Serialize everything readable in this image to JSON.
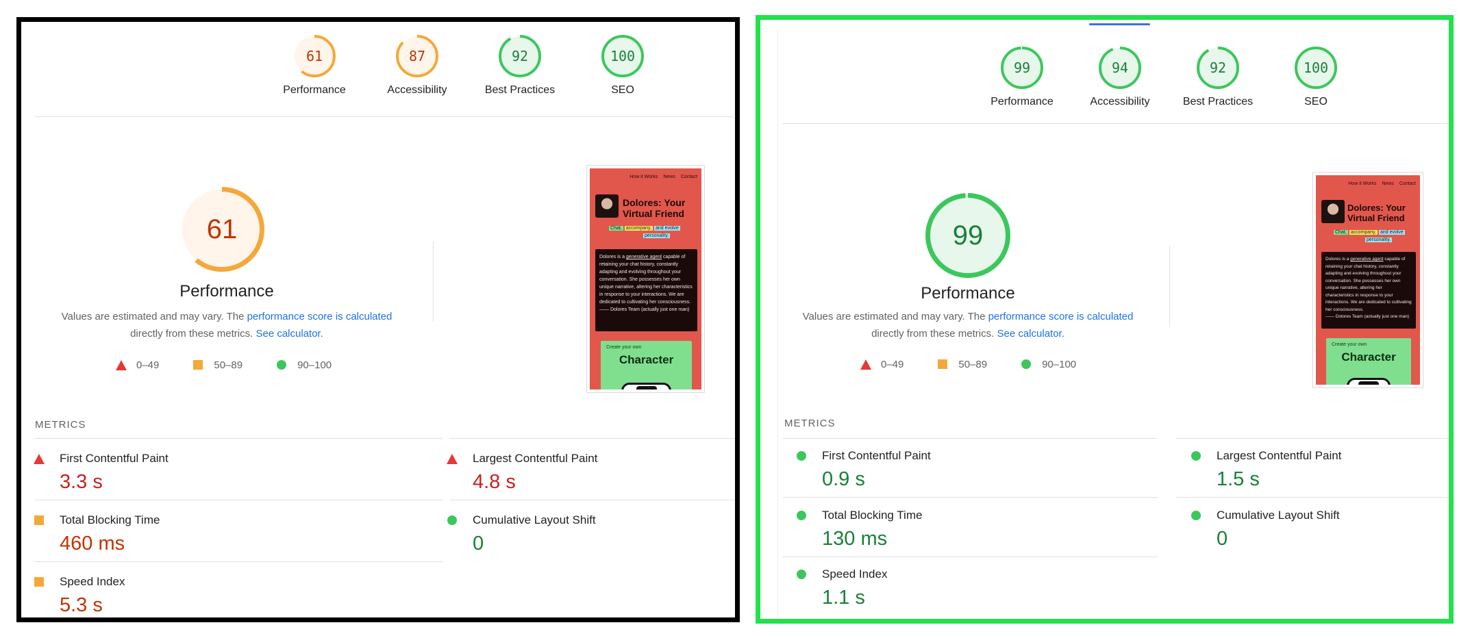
{
  "panels": [
    {
      "id": "left",
      "categories": [
        {
          "score": "61",
          "label": "Performance",
          "fraction": 0.61,
          "rating": "average"
        },
        {
          "score": "87",
          "label": "Accessibility",
          "fraction": 0.87,
          "rating": "average"
        },
        {
          "score": "92",
          "label": "Best Practices",
          "fraction": 0.92,
          "rating": "pass"
        },
        {
          "score": "100",
          "label": "SEO",
          "fraction": 1.0,
          "rating": "pass"
        }
      ],
      "main_score": "61",
      "main_fraction": 0.61,
      "main_rating": "average",
      "main_title": "Performance",
      "note_prefix": "Values are estimated and may vary. The ",
      "note_link1": "performance score is calculated",
      "note_mid": "directly from these metrics. ",
      "note_link2": "See calculator.",
      "legend": [
        "0–49",
        "50–89",
        "90–100"
      ],
      "metrics_heading": "METRICS",
      "metrics": [
        {
          "name": "First Contentful Paint",
          "value": "3.3 s",
          "rating": "fail"
        },
        {
          "name": "Largest Contentful Paint",
          "value": "4.8 s",
          "rating": "fail"
        },
        {
          "name": "Total Blocking Time",
          "value": "460 ms",
          "rating": "average"
        },
        {
          "name": "Cumulative Layout Shift",
          "value": "0",
          "rating": "pass"
        },
        {
          "name": "Speed Index",
          "value": "5.3 s",
          "rating": "average"
        }
      ]
    },
    {
      "id": "right",
      "categories": [
        {
          "score": "99",
          "label": "Performance",
          "fraction": 0.99,
          "rating": "pass"
        },
        {
          "score": "94",
          "label": "Accessibility",
          "fraction": 0.94,
          "rating": "pass"
        },
        {
          "score": "92",
          "label": "Best Practices",
          "fraction": 0.92,
          "rating": "pass"
        },
        {
          "score": "100",
          "label": "SEO",
          "fraction": 1.0,
          "rating": "pass"
        }
      ],
      "main_score": "99",
      "main_fraction": 0.99,
      "main_rating": "pass",
      "main_title": "Performance",
      "note_prefix": "Values are estimated and may vary. The ",
      "note_link1": "performance score is calculated",
      "note_mid": "directly from these metrics. ",
      "note_link2": "See calculator.",
      "legend": [
        "0–49",
        "50–89",
        "90–100"
      ],
      "metrics_heading": "METRICS",
      "metrics": [
        {
          "name": "First Contentful Paint",
          "value": "0.9 s",
          "rating": "pass"
        },
        {
          "name": "Largest Contentful Paint",
          "value": "1.5 s",
          "rating": "pass"
        },
        {
          "name": "Total Blocking Time",
          "value": "130 ms",
          "rating": "pass"
        },
        {
          "name": "Cumulative Layout Shift",
          "value": "0",
          "rating": "pass"
        },
        {
          "name": "Speed Index",
          "value": "1.1 s",
          "rating": "pass"
        }
      ]
    }
  ],
  "preview": {
    "nav": [
      "How it Works",
      "News",
      "Contact"
    ],
    "title_line1": "Dolores: Your",
    "title_line2": "Virtual Friend",
    "tags": [
      "Chat,",
      "accompany,",
      "and evolve",
      "personality."
    ],
    "body_pre": "Dolores is a ",
    "body_link": "generative agent",
    "body_post": " capable of retaining your chat history, constantly adapting and evolving throughout your conversation. She possesses her own unique narrative, altering her characteristics in response to your interactions. We are dedicated to cultivating her consciousness.",
    "signature": "—— Dolores Team (actually just one man)",
    "card_small": "Create your own",
    "card_big": "Character"
  },
  "colors": {
    "fail": "#e53935",
    "average": "#f4a83a",
    "pass": "#3cc75c",
    "fail_text": "#c5221f",
    "average_text": "#c33300",
    "pass_text": "#188038",
    "fail_bg": "#fdecea",
    "average_bg": "#fff5ea",
    "pass_bg": "#e8f7ec",
    "left_frame": "#000000",
    "right_frame": "#22e14b",
    "link": "#1a73e8"
  }
}
